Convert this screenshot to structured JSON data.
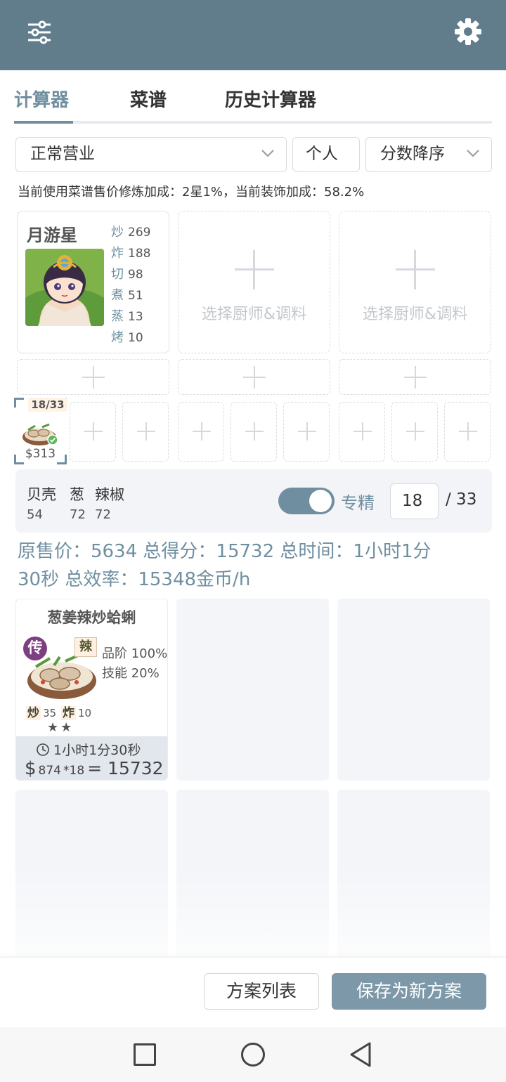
{
  "header": {
    "menu_icon": "sliders-icon",
    "settings_icon": "gear-icon",
    "bg_color": "#617d8c"
  },
  "tabs": [
    {
      "label": "计算器",
      "active": true
    },
    {
      "label": "菜谱",
      "active": false
    },
    {
      "label": "历史计算器",
      "active": false
    }
  ],
  "filters": {
    "mode": "正常营业",
    "scope": "个人",
    "sort": "分数降序"
  },
  "bonus_text": "当前使用菜谱售价修炼加成：2星1%，当前装饰加成：58.2%",
  "chef": {
    "name": "月游星",
    "skills": [
      {
        "key": "炒",
        "value": "269"
      },
      {
        "key": "炸",
        "value": "188"
      },
      {
        "key": "切",
        "value": "98"
      },
      {
        "key": "煮",
        "value": "51"
      },
      {
        "key": "蒸",
        "value": "13"
      },
      {
        "key": "烤",
        "value": "10"
      }
    ]
  },
  "empty_chef_label": "选择厨师&调料",
  "selected_recipe_slot": {
    "count": "18/33",
    "price": "$313"
  },
  "ingredients": [
    {
      "name": "贝壳",
      "value": "54"
    },
    {
      "name": "葱",
      "value": "72"
    },
    {
      "name": "辣椒",
      "value": "72"
    }
  ],
  "mastery": {
    "label": "专精",
    "enabled": true,
    "current": "18",
    "max": "/ 33"
  },
  "summary": {
    "line1": "原售价：5634 总得分：15732 总时间：1小时1分",
    "line2": "30秒 总效率：15348金币/h"
  },
  "dish": {
    "name": "葱姜辣炒蛤蜊",
    "rarity_badge": "传",
    "taste_badge": "辣",
    "quality": "品阶 100%",
    "skill_bonus": "技能 20%",
    "req": [
      {
        "key": "炒",
        "value": "35"
      },
      {
        "key": "炸",
        "value": "10"
      }
    ],
    "stars": "★★",
    "time": "1小时1分30秒",
    "currency": "$",
    "unit_price": "874",
    "qty": "*18",
    "total": "= 15732"
  },
  "actions": {
    "list_label": "方案列表",
    "save_label": "保存为新方案"
  },
  "accent_color": "#6f8fa1"
}
